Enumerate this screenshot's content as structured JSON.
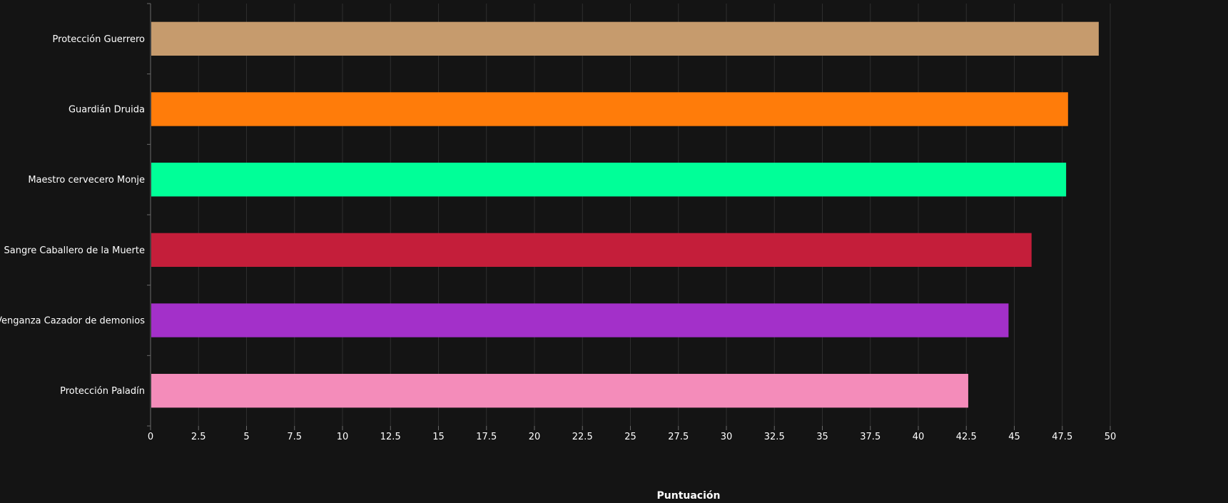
{
  "chart_data": {
    "type": "bar",
    "orientation": "horizontal",
    "categories": [
      "Protección Guerrero",
      "Guardián Druida",
      "Maestro cervecero Monje",
      "Sangre Caballero de la Muerte",
      "Venganza Cazador de demonios",
      "Protección Paladín"
    ],
    "values": [
      49.4,
      47.8,
      47.7,
      45.9,
      44.7,
      42.6
    ],
    "colors": [
      "#C69B6D",
      "#FF7C0A",
      "#00FF98",
      "#C41E3A",
      "#A330C9",
      "#F48CBA"
    ],
    "xlabel": "Puntuación",
    "ylabel": "",
    "xlim": [
      0,
      50
    ],
    "xticks": [
      "0",
      "2.5",
      "5",
      "7.5",
      "10",
      "12.5",
      "15",
      "17.5",
      "20",
      "22.5",
      "25",
      "27.5",
      "30",
      "32.5",
      "35",
      "37.5",
      "40",
      "42.5",
      "45",
      "47.5",
      "50"
    ],
    "grid": true,
    "background": "#141414",
    "gridColor": "#2e2e2e",
    "textColor": "#ffffff"
  }
}
